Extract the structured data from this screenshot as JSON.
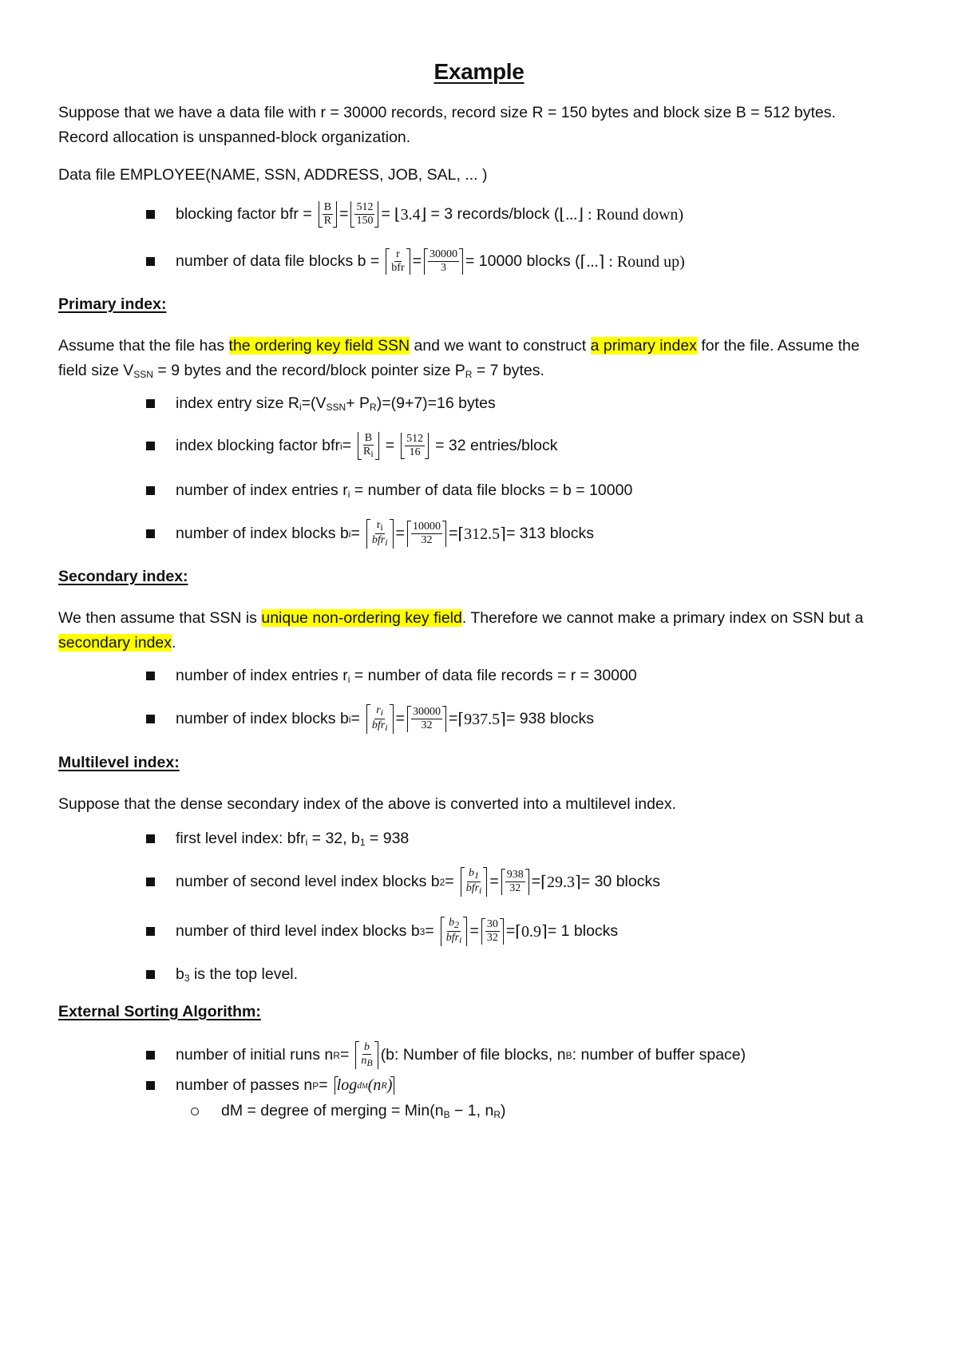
{
  "title": "Example",
  "intro": {
    "line1": "Suppose that we have a data file with r = 30000 records, record size R = 150 bytes and block size B = 512 bytes.",
    "line2": "Record allocation is unspanned-block organization.",
    "data_file": "Data file EMPLOYEE(NAME, SSN, ADDRESS, JOB, SAL, ... )"
  },
  "basics": {
    "bfr": {
      "label": "blocking factor bfr =",
      "f1_num": "B",
      "f1_den": "R",
      "eq": "=",
      "f2_num": "512",
      "f2_den": "150",
      "result_pre": "=",
      "floor_value": "3.4",
      "result": "= 3 records/block (",
      "floor_dots": "...",
      "note": ": Round down)"
    },
    "b": {
      "label": "number of data file blocks b =",
      "f1_num": "r",
      "f1_den": "bfr",
      "eq": "=",
      "f2_num": "30000",
      "f2_den": "3",
      "result": "= 10000 blocks (",
      "ceil_dots": "...",
      "note": ": Round up)"
    }
  },
  "primary": {
    "heading": "Primary index:",
    "para": {
      "t1": "Assume that the file has ",
      "h1": "the ordering key field SSN",
      "t2": " and we want to construct ",
      "h2": "a primary index",
      "t3": " for the file. Assume the",
      "l2a": "field size V",
      "l2_sub1": "SSN",
      "l2b": " = 9 bytes and the record/block pointer size P",
      "l2_sub2": "R",
      "l2c": " = 7 bytes."
    },
    "entry_size": {
      "a": "index entry size R",
      "sub_i": "i",
      "b": "=(V",
      "sub_ssn": "SSN",
      "c": "+ P",
      "sub_r": "R",
      "d": ")=(9+7)=16 bytes"
    },
    "bfri": {
      "label": "index blocking factor bfr",
      "sub_i": "i",
      "eq0": "=",
      "f1_num": "B",
      "f1_den": "R",
      "f1_den_sub": "i",
      "eq": "=",
      "f2_num": "512",
      "f2_den": "16",
      "result": "= 32 entries/block"
    },
    "ri": {
      "a": "number of index entries r",
      "sub_i": "i",
      "b": " = number of data file blocks = b = 10000"
    },
    "bi": {
      "label": "number of index blocks b",
      "sub_i": "i",
      "eq0": " =",
      "f1_num": "r",
      "f1_num_sub": "i",
      "f1_den": "bfr",
      "f1_den_sub": "i",
      "eq": "=",
      "f2_num": "10000",
      "f2_den": "32",
      "eq2": "=",
      "ceil_value": "312.5",
      "result": "= 313 blocks"
    }
  },
  "secondary": {
    "heading": "Secondary index:",
    "para": {
      "t1": "We then assume that SSN is ",
      "h1": "unique non-ordering key field",
      "t2": ". Therefore we cannot make a primary index on SSN but a",
      "h2": "secondary index",
      "t3": "."
    },
    "ri": {
      "a": "number of index entries r",
      "sub_i": "i",
      "b": " = number of data file records = r = 30000"
    },
    "bi": {
      "label": "number of index blocks b",
      "sub_i": "i",
      "eq0": " =",
      "f1_num": "r",
      "f1_num_sub": "i",
      "f1_den": "bfr",
      "f1_den_sub": "i",
      "eq": "=",
      "f2_num": "30000",
      "f2_den": "32",
      "eq2": "=",
      "ceil_value": "937.5",
      "result": "= 938 blocks"
    }
  },
  "multilevel": {
    "heading": "Multilevel index:",
    "para": "Suppose that the dense secondary index of the above is converted into a multilevel index.",
    "first": {
      "a": "first level index: bfr",
      "sub_i": "i",
      "b": " = 32, b",
      "sub_1": "1",
      "c": " = 938"
    },
    "second": {
      "label": "number of second level index blocks b",
      "sub": "2",
      "eq0": " =",
      "f1_num": "b",
      "f1_num_sub": "1",
      "f1_den": "bfr",
      "f1_den_sub": "i",
      "eq": "=",
      "f2_num": "938",
      "f2_den": "32",
      "eq2": "=",
      "ceil_value": "29.3",
      "result": "= 30 blocks"
    },
    "third": {
      "label": "number of third level index blocks b",
      "sub": "3",
      "eq0": " =",
      "f1_num": "b",
      "f1_num_sub": "2",
      "f1_den": "bfr",
      "f1_den_sub": "i",
      "eq": "=",
      "f2_num": "30",
      "f2_den": "32",
      "eq2": "=",
      "ceil_value": "0.9",
      "result": "= 1 blocks"
    },
    "top": {
      "a": "b",
      "sub": "3",
      "b": " is the top level."
    }
  },
  "external": {
    "heading": "External Sorting Algorithm:",
    "runs": {
      "label": "number of initial runs n",
      "sub": "R",
      "eq0": " =",
      "f_num": "b",
      "f_den": "n",
      "f_den_sub": "B",
      "note_a": "(b: Number of file blocks, n",
      "note_sub": "B",
      "note_b": ": number of buffer space)"
    },
    "passes": {
      "label": "number of passes n",
      "sub": "P",
      "eq0": " =",
      "log": "log",
      "log_sub": "d",
      "log_subsub": "M",
      "arg_open": "(n",
      "arg_sub": "R",
      "arg_close": ")"
    },
    "dm": {
      "a": "dM = degree of merging = Min(n",
      "sub_b": "B",
      "b": " − 1, n",
      "sub_r": "R",
      "c": ")"
    }
  }
}
